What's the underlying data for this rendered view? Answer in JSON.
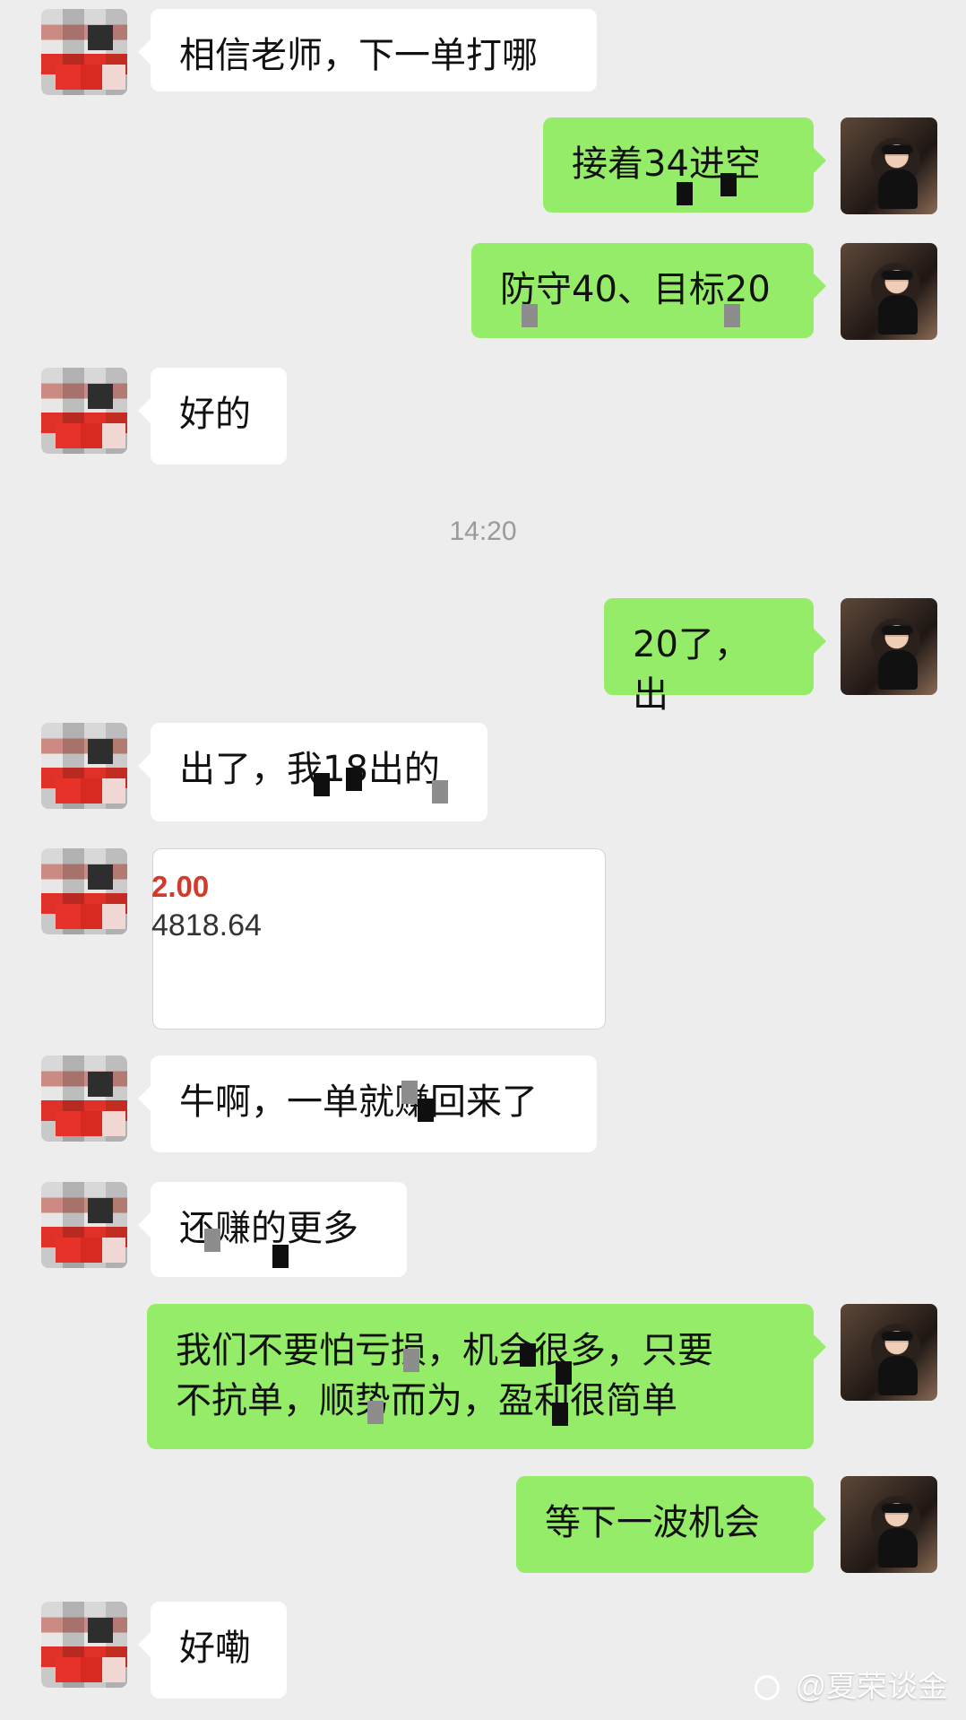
{
  "messages": [
    {
      "side": "left",
      "text": "相信老师，下一单打哪"
    },
    {
      "side": "right",
      "text": "接着34进空"
    },
    {
      "side": "right",
      "text": "防守40、目标20"
    },
    {
      "side": "left",
      "text": "好的"
    },
    {
      "side": "right",
      "text": "20了，出"
    },
    {
      "side": "left",
      "text": "出了，我18出的"
    },
    {
      "side": "left",
      "text": "牛啊，一单就赚回来了"
    },
    {
      "side": "left",
      "text": "还赚的更多"
    },
    {
      "side": "right",
      "text": "我们不要怕亏损，机会很多，只要\n不抗单，顺势而为，盈利很简单"
    },
    {
      "side": "right",
      "text": "等下一波机会"
    },
    {
      "side": "left",
      "text": "好嘞"
    }
  ],
  "timestamp": "14:20",
  "screenshot_card": {
    "value_red": "2.00",
    "value_main": "4818.64"
  },
  "watermark": "@夏荣谈金"
}
